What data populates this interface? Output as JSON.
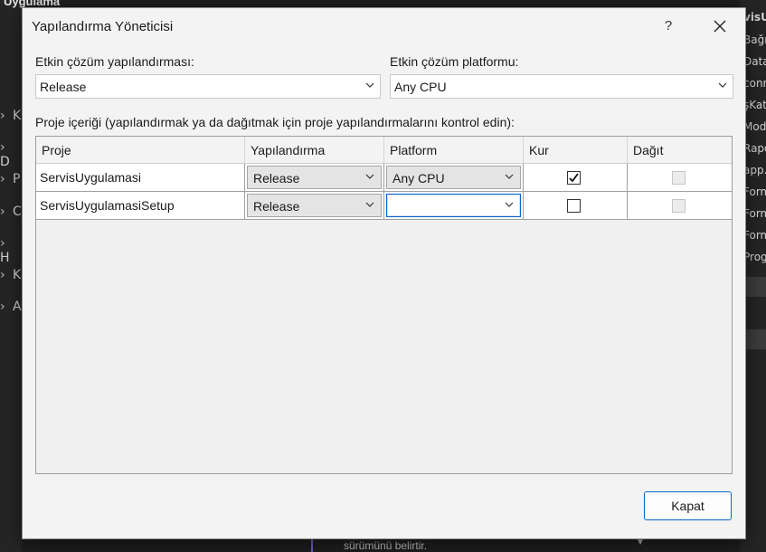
{
  "dialog": {
    "title": "Yapılandırma Yöneticisi",
    "help_label": "?"
  },
  "solution_config": {
    "label": "Etkin çözüm yapılandırması:",
    "value": "Release"
  },
  "solution_platform": {
    "label": "Etkin çözüm platformu:",
    "value": "Any CPU"
  },
  "contexts": {
    "label": "Proje içeriği (yapılandırmak ya da dağıtmak için proje yapılandırmalarını kontrol edin):",
    "columns": [
      "Proje",
      "Yapılandırma",
      "Platform",
      "Kur",
      "Dağıt"
    ],
    "rows": [
      {
        "project": "ServisUygulamasi",
        "configuration": "Release",
        "platform": "Any CPU",
        "build": true,
        "deploy": false
      },
      {
        "project": "ServisUygulamasiSetup",
        "configuration": "Release",
        "platform": "",
        "build": false,
        "deploy": false
      }
    ]
  },
  "close_button": "Kapat",
  "background": {
    "top_left": "Uygulama",
    "left_items": [
      "K",
      "D",
      "P",
      "C",
      "H",
      "K",
      "A"
    ],
    "right_items": [
      "Bağı",
      "Data",
      "conn",
      "şKat",
      "Mod",
      "Rapo",
      "app.",
      "Form",
      "Form",
      "Form",
      "Prog"
    ],
    "right_header": "visU",
    "bottom_text": "sürümünü belirtir."
  },
  "colors": {
    "accent": "#0a64c8",
    "dialog_bg": "#f3f3f3"
  }
}
